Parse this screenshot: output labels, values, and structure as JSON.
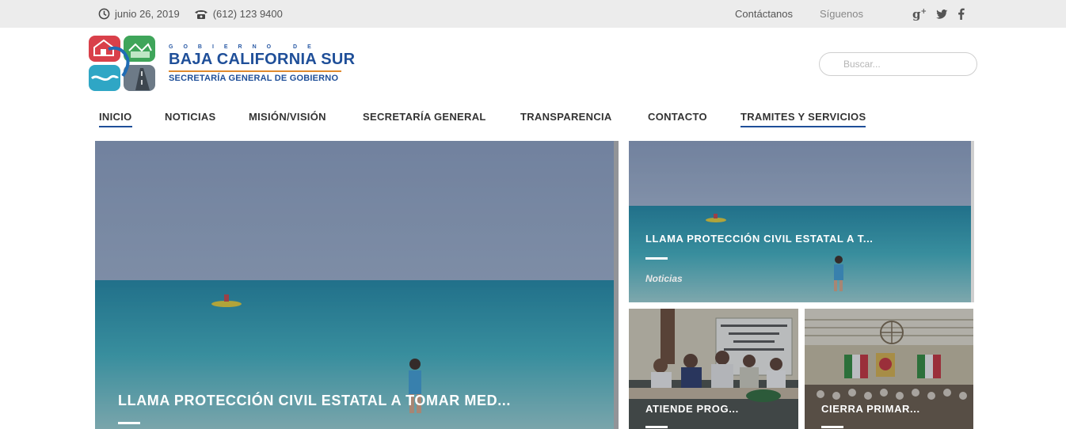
{
  "topbar": {
    "date": "junio 26, 2019",
    "phone": "(612) 123 9400",
    "contact_link": "Contáctanos",
    "follow_label": "Síguenos",
    "social": [
      "google-plus-icon",
      "twitter-icon",
      "facebook-icon"
    ]
  },
  "brand": {
    "line1": "GOBIERNO DE",
    "line2": "BAJA CALIFORNIA SUR",
    "line3": "SECRETARÍA GENERAL DE GOBIERNO"
  },
  "search": {
    "placeholder": "Buscar..."
  },
  "nav": {
    "items": [
      {
        "label": "INICIO"
      },
      {
        "label": "NOTICIAS"
      },
      {
        "label": "MISIÓN/VISIÓN"
      },
      {
        "label": "SECRETARÍA GENERAL"
      },
      {
        "label": "TRANSPARENCIA"
      },
      {
        "label": "CONTACTO"
      },
      {
        "label": "TRAMITES Y SERVICIOS"
      }
    ]
  },
  "featured": {
    "main": {
      "title": "LLAMA PROTECCIÓN CIVIL ESTATAL A TOMAR MED..."
    },
    "top_right": {
      "title": "LLAMA PROTECCIÓN CIVIL ESTATAL A T...",
      "category": "Noticias"
    },
    "bottom_left": {
      "title": "ATIENDE PROG..."
    },
    "bottom_right": {
      "title": "CIERRA PRIMAR..."
    }
  },
  "colors": {
    "brand_blue": "#1f4f99",
    "accent_orange": "#e08a2e",
    "topbar_bg": "#ececec"
  }
}
